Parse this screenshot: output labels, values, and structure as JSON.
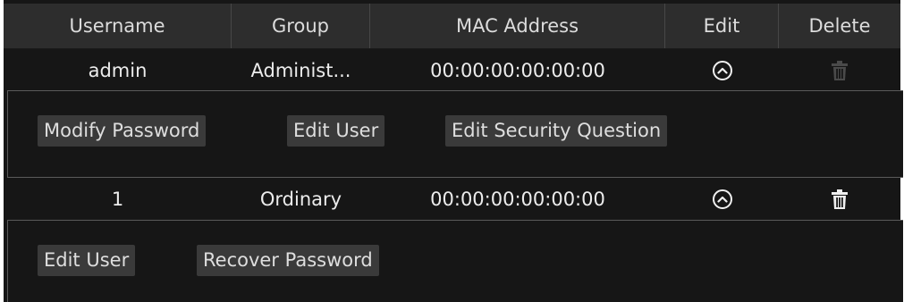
{
  "table": {
    "headers": [
      "Username",
      "Group",
      "MAC Address",
      "Edit",
      "Delete"
    ]
  },
  "users": [
    {
      "username": "admin",
      "group": "Administ...",
      "mac": "00:00:00:00:00:00",
      "edit_icon": "chevron-up-circle-icon",
      "delete_icon": "trash-icon",
      "delete_enabled": false,
      "actions": [
        "Modify Password",
        "Edit User",
        "Edit Security Question"
      ]
    },
    {
      "username": "1",
      "group": "Ordinary",
      "mac": "00:00:00:00:00:00",
      "edit_icon": "chevron-up-circle-icon",
      "delete_icon": "trash-icon",
      "delete_enabled": true,
      "actions": [
        "Edit User",
        "Recover Password"
      ]
    }
  ],
  "colors": {
    "background": "#161616",
    "header": "#2d2d2d",
    "button": "#3a3a3a",
    "text": "#e6e6e6",
    "disabled_icon": "#4a4a4a"
  }
}
